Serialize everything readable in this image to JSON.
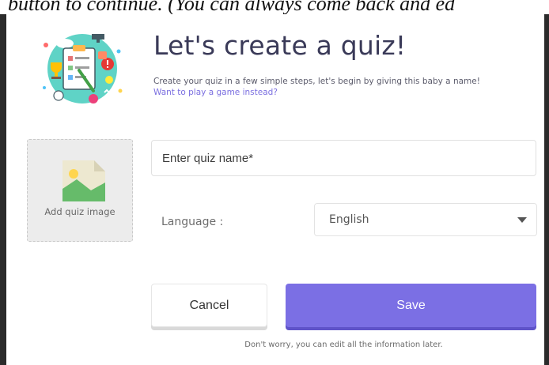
{
  "background": {
    "partial_text": "button to continue. (You can always come back and ed"
  },
  "modal": {
    "title": "Let's create a quiz!",
    "description": "Create your quiz in a few simple steps, let's begin by giving this baby a name!",
    "game_link": "Want to play a game instead?",
    "hero_icon": "quiz-illustration-icon"
  },
  "image_upload": {
    "label": "Add quiz image",
    "icon": "image-placeholder-icon"
  },
  "name_input": {
    "placeholder": "Enter quiz name*",
    "value": ""
  },
  "language": {
    "label": "Language :",
    "selected": "English",
    "icon": "caret-down-icon"
  },
  "buttons": {
    "cancel": "Cancel",
    "save": "Save"
  },
  "footer_note": "Don't worry, you can edit all the information later.",
  "colors": {
    "accent": "#7b6fe4",
    "link": "#7a6ee0",
    "title": "#3a3a58"
  }
}
